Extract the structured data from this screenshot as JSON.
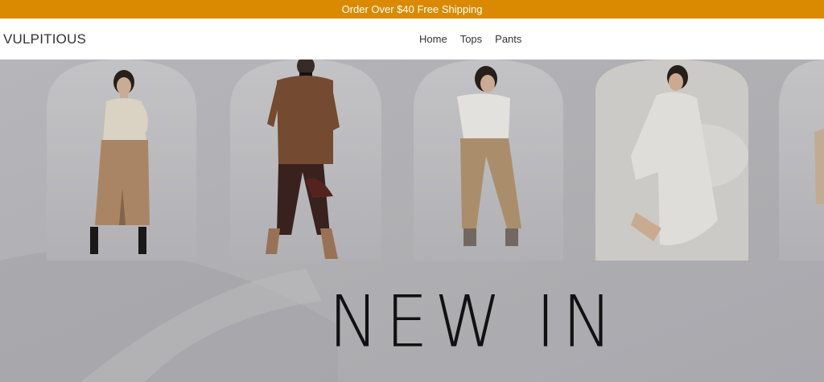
{
  "announcement": {
    "text": "Order Over $40 Free Shipping"
  },
  "header": {
    "logo": "VULPITIOUS",
    "nav": [
      {
        "label": "Home"
      },
      {
        "label": "Tops"
      },
      {
        "label": "Pants"
      }
    ]
  },
  "hero": {
    "title": "NEW IN",
    "photos": [
      {
        "name": "model-knit-top-skirt"
      },
      {
        "name": "model-brown-jacket-bag"
      },
      {
        "name": "model-white-tee-cargo"
      },
      {
        "name": "model-white-dress-seated"
      },
      {
        "name": "model-partial-right"
      }
    ]
  },
  "colors": {
    "announcement_bg": "#d98a00",
    "hero_bg": "#b9b9bd",
    "title": "#111111"
  }
}
